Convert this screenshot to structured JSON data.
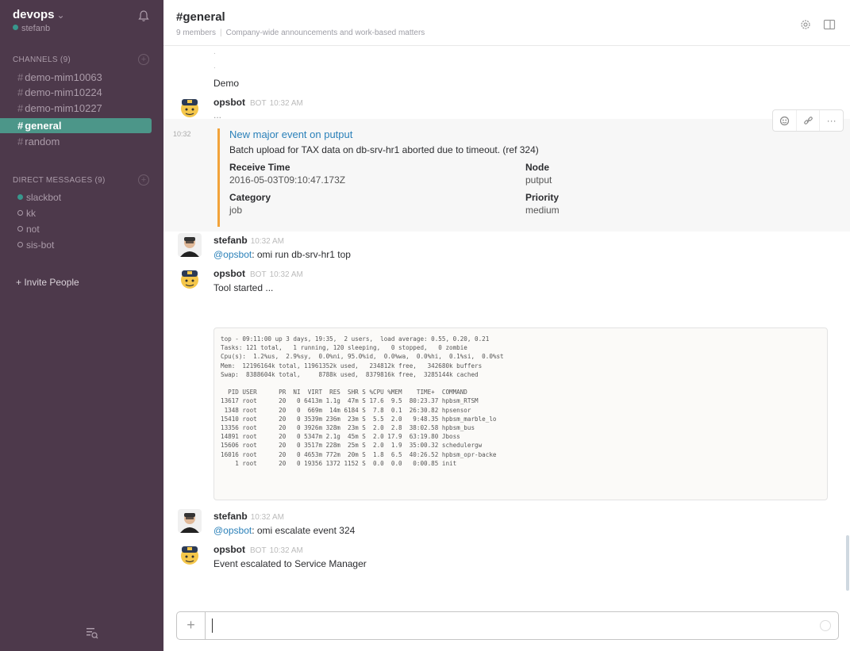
{
  "sidebar": {
    "team_name": "devops",
    "team_caret": "⌄",
    "username": "stefanb",
    "channels_header": "CHANNELS (9)",
    "channels": [
      {
        "label": "demo-mim10063"
      },
      {
        "label": "demo-mim10224"
      },
      {
        "label": "demo-mim10227"
      },
      {
        "label": "general"
      },
      {
        "label": "random"
      }
    ],
    "dm_header": "DIRECT MESSAGES (9)",
    "dms": [
      {
        "label": "slackbot"
      },
      {
        "label": "kk"
      },
      {
        "label": "not"
      },
      {
        "label": "sis-bot"
      }
    ],
    "invite": "+ Invite People"
  },
  "header": {
    "channel": "#general",
    "members": "9 members",
    "purpose": "Company-wide announcements and work-based matters"
  },
  "messages": {
    "demo_text": "Demo",
    "opsbot1": {
      "name": "opsbot",
      "bot_tag": "BOT",
      "time": "10:32 AM",
      "body": "..."
    },
    "hover_time": "10:32",
    "attachment": {
      "title": "New major event on putput",
      "text": "Batch upload for TAX data on db-srv-hr1 aborted due to timeout. (ref 324)",
      "fields": [
        {
          "label": "Receive Time",
          "value": "2016-05-03T09:10:47.173Z"
        },
        {
          "label": "Node",
          "value": "putput"
        },
        {
          "label": "Category",
          "value": "job"
        },
        {
          "label": "Priority",
          "value": "medium"
        }
      ]
    },
    "stefanb1": {
      "name": "stefanb",
      "time": "10:32 AM",
      "mention": "@opsbot",
      "body": ": omi run db-srv-hr1 top"
    },
    "opsbot2": {
      "name": "opsbot",
      "bot_tag": "BOT",
      "time": "10:32 AM",
      "body": "Tool started ..."
    },
    "code": "top - 09:11:00 up 3 days, 19:35,  2 users,  load average: 0.55, 0.20, 0.21\nTasks: 121 total,   1 running, 120 sleeping,   0 stopped,   0 zombie\nCpu(s):  1.2%us,  2.9%sy,  0.0%ni, 95.0%id,  0.0%wa,  0.0%hi,  0.1%si,  0.0%st\nMem:  12196164k total, 11961352k used,   234812k free,   342680k buffers\nSwap:  8388604k total,     8788k used,  8379816k free,  3285144k cached\n\n  PID USER      PR  NI  VIRT  RES  SHR S %CPU %MEM    TIME+  COMMAND\n13617 root      20   0 6413m 1.1g  47m S 17.6  9.5  80:23.37 hpbsm_RTSM\n 1348 root      20   0  669m  14m 6184 S  7.8  0.1  26:30.82 hpsensor\n15410 root      20   0 3539m 236m  23m S  5.5  2.0   9:48.35 hpbsm_marble_lo\n13356 root      20   0 3926m 328m  23m S  2.0  2.8  38:02.58 hpbsm_bus\n14891 root      20   0 5347m 2.1g  45m S  2.0 17.9  63:19.80 Jboss\n15606 root      20   0 3517m 228m  25m S  2.0  1.9  35:00.32 schedulergw\n16016 root      20   0 4653m 772m  20m S  1.8  6.5  40:26.52 hpbsm_opr-backe\n    1 root      20   0 19356 1372 1152 S  0.0  0.0   0:00.85 init",
    "stefanb2": {
      "name": "stefanb",
      "time": "10:32 AM",
      "mention": "@opsbot",
      "body": ": omi escalate event 324"
    },
    "opsbot3": {
      "name": "opsbot",
      "bot_tag": "BOT",
      "time": "10:32 AM",
      "body": "Event escalated to Service Manager"
    }
  },
  "composer": {
    "plus": "+",
    "value": ""
  },
  "colors": {
    "sidebar_bg": "#4d394b",
    "active_channel": "#4c9689",
    "attachment_bar": "#f2a33a",
    "link": "#2a80b9"
  },
  "icons": [
    "bell-icon",
    "gear-icon",
    "panel-icon",
    "emoji-reaction-icon",
    "link-icon",
    "more-icon",
    "filter-icon",
    "bot-avatar",
    "user-avatar"
  ]
}
